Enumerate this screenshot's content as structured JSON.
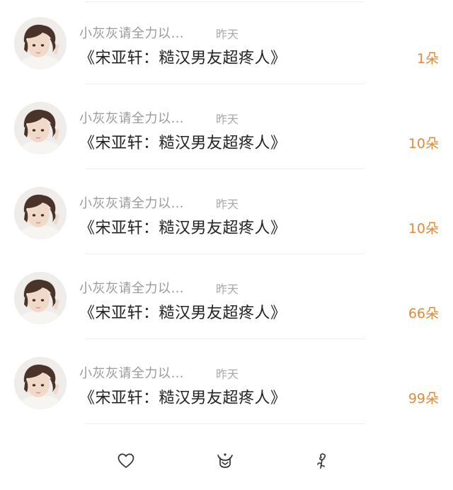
{
  "feed": {
    "items": [
      {
        "username": "小灰灰请全力以…",
        "time": "昨天",
        "title": "《宋亚轩：糙汉男友超疼人》",
        "gift": "1朵"
      },
      {
        "username": "小灰灰请全力以…",
        "time": "昨天",
        "title": "《宋亚轩：糙汉男友超疼人》",
        "gift": "10朵"
      },
      {
        "username": "小灰灰请全力以…",
        "time": "昨天",
        "title": "《宋亚轩：糙汉男友超疼人》",
        "gift": "10朵"
      },
      {
        "username": "小灰灰请全力以…",
        "time": "昨天",
        "title": "《宋亚轩：糙汉男友超疼人》",
        "gift": "66朵"
      },
      {
        "username": "小灰灰请全力以…",
        "time": "昨天",
        "title": "《宋亚轩：糙汉男友超疼人》",
        "gift": "99朵"
      }
    ]
  },
  "bottom_bar": {
    "icons": [
      "heart-icon",
      "trophy-icon",
      "flower-icon"
    ]
  },
  "colors": {
    "gift_accent": "#e08a3c",
    "username_gray": "#9a9a9a",
    "title_dark": "#222222"
  }
}
